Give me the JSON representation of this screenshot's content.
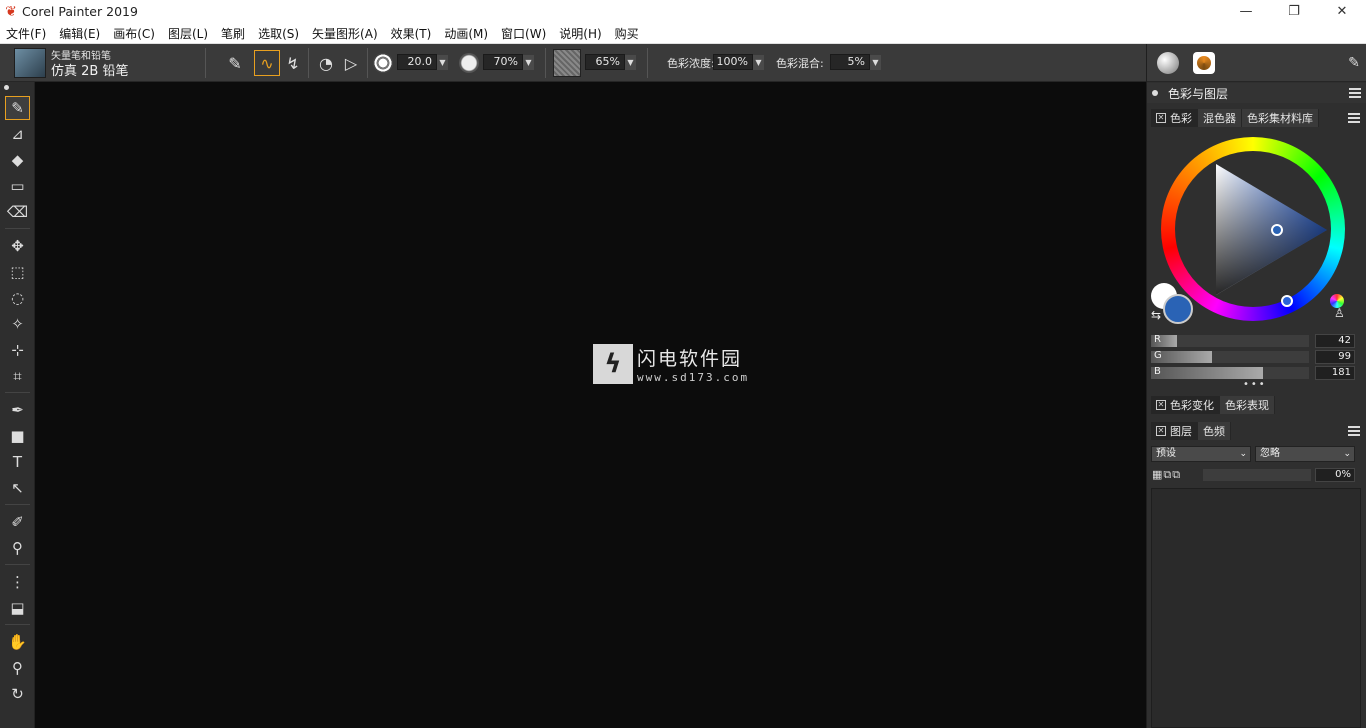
{
  "window": {
    "title": "Corel Painter 2019",
    "minimize": "—",
    "restore": "❐",
    "close": "✕"
  },
  "menu": {
    "items": [
      "文件(F)",
      "编辑(E)",
      "画布(C)",
      "图层(L)",
      "笔刷",
      "选取(S)",
      "矢量图形(A)",
      "效果(T)",
      "动画(M)",
      "窗口(W)",
      "说明(H)",
      "购买"
    ]
  },
  "property_bar": {
    "brush_category": "矢量笔和铅笔",
    "brush_variant": "仿真 2B 铅笔",
    "size_value": "20.0",
    "opacity_value": "70%",
    "grain_value": "65%",
    "color_strength_label": "色彩浓度:",
    "color_strength_value": "100%",
    "color_mix_label": "色彩混合:",
    "color_mix_value": "5%"
  },
  "watermark": {
    "title": "闪电软件园",
    "url": "www.sd173.com"
  },
  "color_panel": {
    "group_title": "色彩与图层",
    "tabs": [
      "色彩",
      "混色器",
      "色彩集材料库"
    ],
    "r_label": "R",
    "g_label": "G",
    "b_label": "B",
    "r_value": "42",
    "g_value": "99",
    "b_value": "181",
    "main_color": "#2a63b5",
    "secondary_color": "#ffffff",
    "variation_tabs": [
      "色彩变化",
      "色彩表现"
    ]
  },
  "layers_panel": {
    "tabs": [
      "图层",
      "色频"
    ],
    "composite_method": "预设",
    "composite_depth": "忽略",
    "opacity_value": "0%"
  },
  "toolbox": {
    "tools": [
      "brush-icon",
      "dropper-icon",
      "paint-bucket-icon",
      "gradient-icon",
      "eraser-icon",
      "layer-adjuster-icon",
      "rect-selection-icon",
      "lasso-icon",
      "magic-wand-icon",
      "selection-adjuster-icon",
      "crop-icon",
      "pen-icon",
      "rectangle-shape-icon",
      "text-icon",
      "shape-selection-icon",
      "cloner-icon",
      "rubber-stamp-icon",
      "mirror-painting-icon",
      "perspective-icon",
      "grabber-icon",
      "magnifier-icon",
      "rotate-page-icon"
    ]
  },
  "colors": {
    "accent": "#e8a020",
    "panel_bg": "#2f2f2f",
    "canvas_bg": "#0c0c0c"
  }
}
